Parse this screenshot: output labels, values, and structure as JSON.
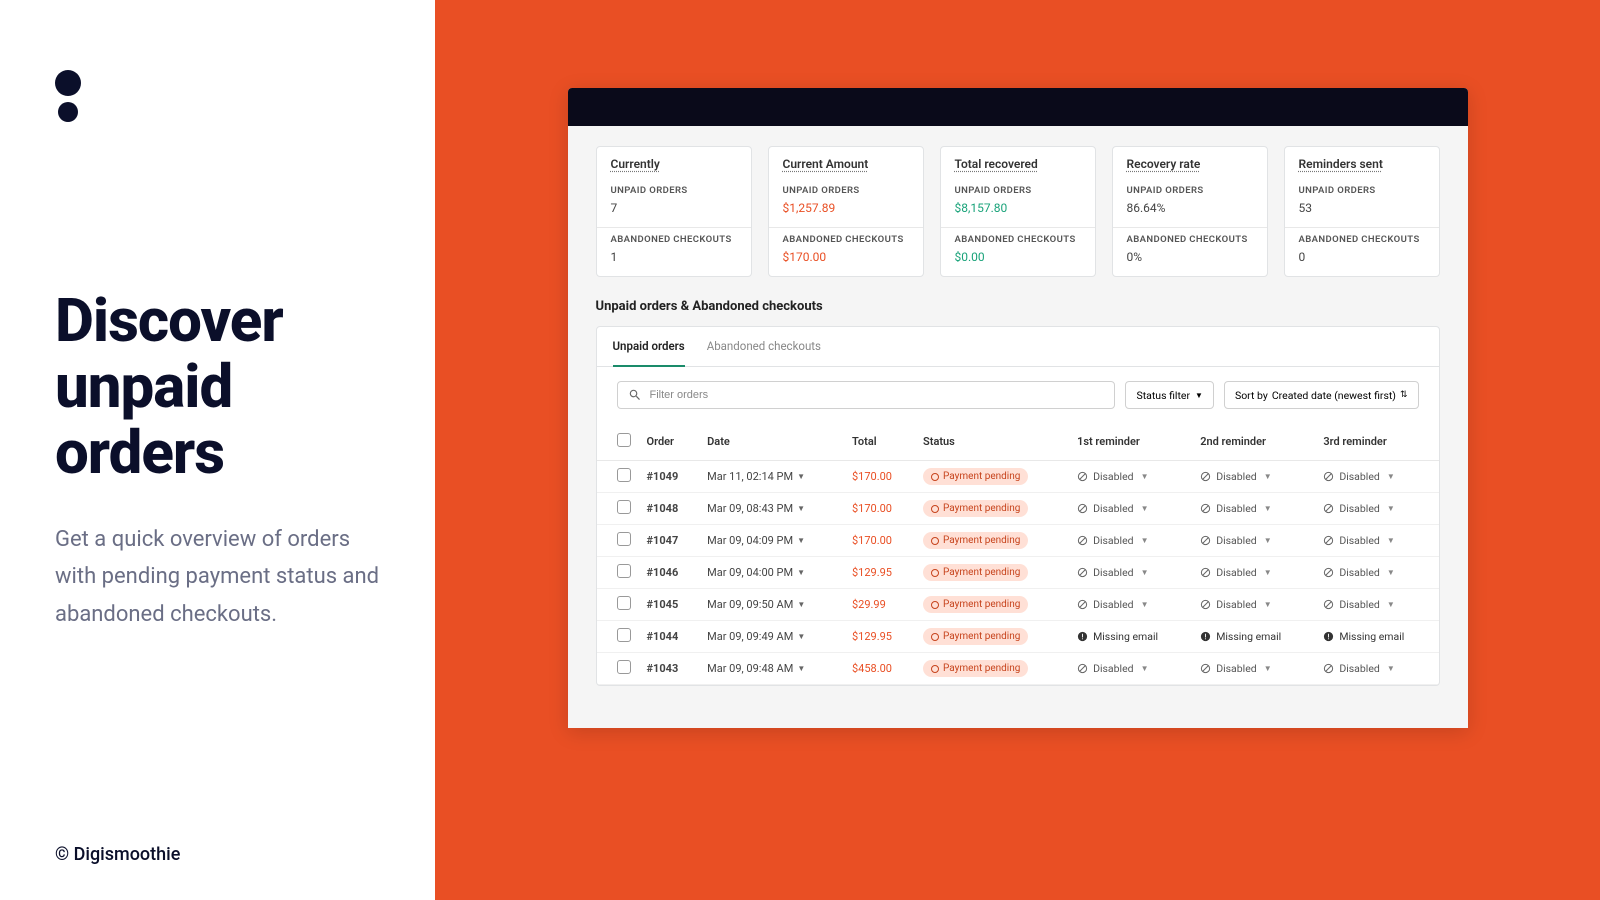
{
  "marketing": {
    "headline": "Discover unpaid orders",
    "subhead": "Get a quick overview of orders with pending payment status and abandoned checkouts.",
    "copyright": "© Digismoothie"
  },
  "stats": [
    {
      "title": "Currently",
      "unpaid_label": "UNPAID ORDERS",
      "unpaid_value": "7",
      "unpaid_class": "",
      "abandoned_label": "ABANDONED CHECKOUTS",
      "abandoned_value": "1",
      "abandoned_class": ""
    },
    {
      "title": "Current Amount",
      "unpaid_label": "UNPAID ORDERS",
      "unpaid_value": "$1,257.89",
      "unpaid_class": "red",
      "abandoned_label": "ABANDONED CHECKOUTS",
      "abandoned_value": "$170.00",
      "abandoned_class": "red"
    },
    {
      "title": "Total recovered",
      "unpaid_label": "UNPAID ORDERS",
      "unpaid_value": "$8,157.80",
      "unpaid_class": "green",
      "abandoned_label": "ABANDONED CHECKOUTS",
      "abandoned_value": "$0.00",
      "abandoned_class": "green"
    },
    {
      "title": "Recovery rate",
      "unpaid_label": "UNPAID ORDERS",
      "unpaid_value": "86.64%",
      "unpaid_class": "",
      "abandoned_label": "ABANDONED CHECKOUTS",
      "abandoned_value": "0%",
      "abandoned_class": ""
    },
    {
      "title": "Reminders sent",
      "unpaid_label": "UNPAID ORDERS",
      "unpaid_value": "53",
      "unpaid_class": "",
      "abandoned_label": "ABANDONED CHECKOUTS",
      "abandoned_value": "0",
      "abandoned_class": ""
    }
  ],
  "section_title": "Unpaid orders & Abandoned checkouts",
  "tabs": {
    "unpaid": "Unpaid orders",
    "abandoned": "Abandoned checkouts"
  },
  "filters": {
    "search_placeholder": "Filter orders",
    "status_filter": "Status filter",
    "sort_prefix": "Sort by ",
    "sort_value": "Created date (newest first)"
  },
  "table": {
    "headers": {
      "order": "Order",
      "date": "Date",
      "total": "Total",
      "status": "Status",
      "r1": "1st reminder",
      "r2": "2nd reminder",
      "r3": "3rd reminder"
    },
    "rows": [
      {
        "id": "#1049",
        "date": "Mar 11, 02:14 PM",
        "total": "$170.00",
        "status": "Payment pending",
        "r1": "Disabled",
        "r2": "Disabled",
        "r3": "Disabled",
        "warn": false
      },
      {
        "id": "#1048",
        "date": "Mar 09, 08:43 PM",
        "total": "$170.00",
        "status": "Payment pending",
        "r1": "Disabled",
        "r2": "Disabled",
        "r3": "Disabled",
        "warn": false
      },
      {
        "id": "#1047",
        "date": "Mar 09, 04:09 PM",
        "total": "$170.00",
        "status": "Payment pending",
        "r1": "Disabled",
        "r2": "Disabled",
        "r3": "Disabled",
        "warn": false
      },
      {
        "id": "#1046",
        "date": "Mar 09, 04:00 PM",
        "total": "$129.95",
        "status": "Payment pending",
        "r1": "Disabled",
        "r2": "Disabled",
        "r3": "Disabled",
        "warn": false
      },
      {
        "id": "#1045",
        "date": "Mar 09, 09:50 AM",
        "total": "$29.99",
        "status": "Payment pending",
        "r1": "Disabled",
        "r2": "Disabled",
        "r3": "Disabled",
        "warn": false
      },
      {
        "id": "#1044",
        "date": "Mar 09, 09:49 AM",
        "total": "$129.95",
        "status": "Payment pending",
        "r1": "Missing email",
        "r2": "Missing email",
        "r3": "Missing email",
        "warn": true
      },
      {
        "id": "#1043",
        "date": "Mar 09, 09:48 AM",
        "total": "$458.00",
        "status": "Payment pending",
        "r1": "Disabled",
        "r2": "Disabled",
        "r3": "Disabled",
        "warn": false
      }
    ]
  }
}
